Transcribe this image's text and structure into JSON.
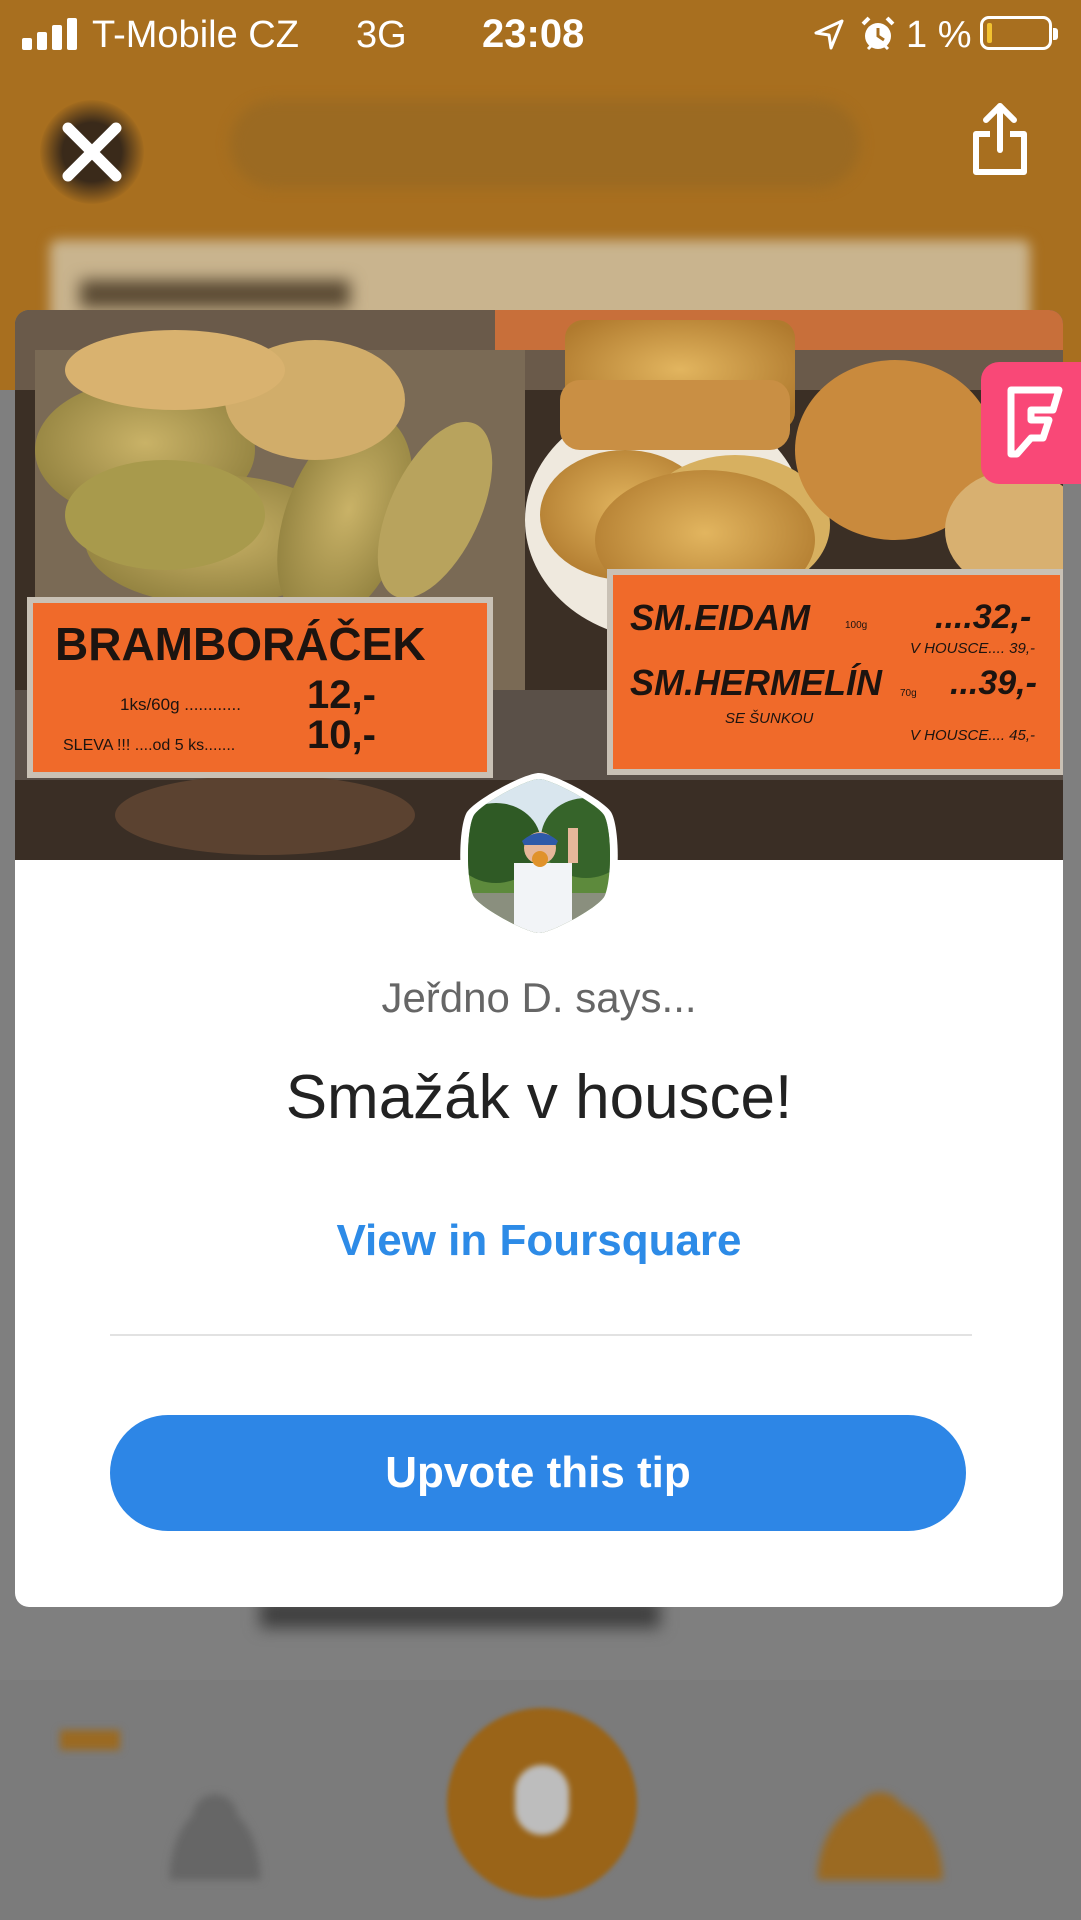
{
  "status_bar": {
    "carrier": "T-Mobile CZ",
    "network": "3G",
    "time": "23:08",
    "battery_percent": "1 %",
    "battery_level": 0.01
  },
  "header": {
    "close_icon": "close-icon",
    "share_icon": "share-icon"
  },
  "tip_card": {
    "photo_signs": {
      "left_title": "BRAMBORÁČEK",
      "left_line1": "1ks/60g ............",
      "left_price1": "12,-",
      "left_line2": "SLEVA !!! ....od 5 ks.......",
      "left_price2": "10,-",
      "right_item1": "SM.EIDAM",
      "right_item1_weight": "100g",
      "right_price1": "....32,-",
      "right_sub1": "V HOUSCE.... 39,-",
      "right_item2": "SM.HERMELÍN",
      "right_item2_weight": "70g",
      "right_price2": "...39,-",
      "right_sub2a": "SE ŠUNKOU",
      "right_sub2b": "V HOUSCE.... 45,-"
    },
    "author_says": "Jeřdno D. says...",
    "tip_text": "Smažák v housce!",
    "view_link": "View in Foursquare",
    "upvote_label": "Upvote this tip"
  },
  "colors": {
    "brand_orange": "#a86f1f",
    "link_blue": "#2d8be7",
    "button_blue": "#2d86e6",
    "foursquare_pink": "#f94877"
  }
}
